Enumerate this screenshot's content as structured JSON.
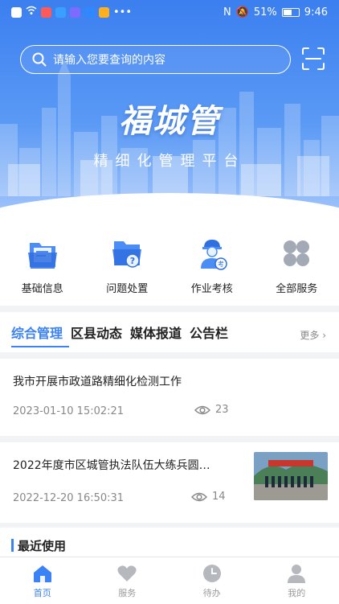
{
  "status_bar": {
    "battery": "51%",
    "time": "9:46"
  },
  "search": {
    "placeholder": "请输入您要查询的内容"
  },
  "brand": {
    "title": "福城管",
    "subtitle": "精细化管理平台"
  },
  "quick_entries": [
    {
      "label": "基础信息",
      "icon": "folder-doc-icon"
    },
    {
      "label": "问题处置",
      "icon": "folder-question-icon"
    },
    {
      "label": "作业考核",
      "icon": "worker-exam-icon"
    },
    {
      "label": "全部服务",
      "icon": "grid-icon"
    }
  ],
  "news": {
    "tabs": [
      "综合管理",
      "区县动态",
      "媒体报道",
      "公告栏"
    ],
    "more": "更多",
    "items": [
      {
        "title": "我市开展市政道路精细化检测工作",
        "date": "2023-01-10 15:02:21",
        "views": "23"
      },
      {
        "title": "2022年度市区城管执法队伍大练兵圆…",
        "date": "2022-12-20 16:50:31",
        "views": "14",
        "has_thumb": true
      }
    ]
  },
  "recent": {
    "title": "最近使用"
  },
  "bottom_nav": [
    {
      "label": "首页",
      "active": true
    },
    {
      "label": "服务"
    },
    {
      "label": "待办"
    },
    {
      "label": "我的"
    }
  ],
  "colors": {
    "primary": "#3b82f6",
    "hero_top": "#3b7ff0"
  }
}
